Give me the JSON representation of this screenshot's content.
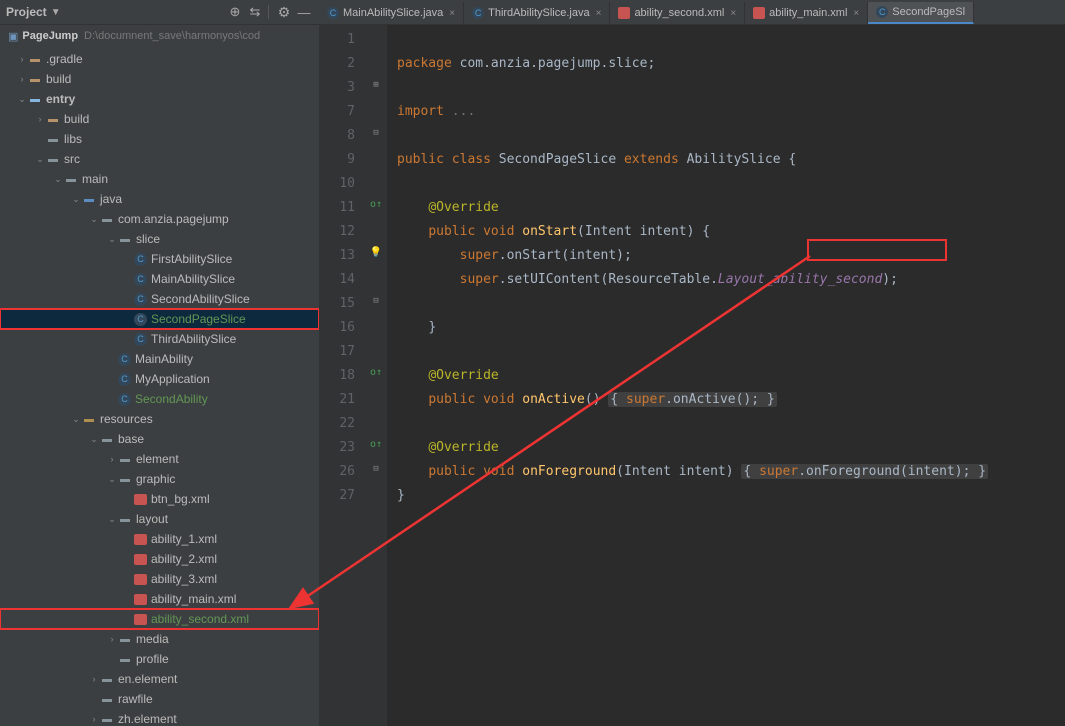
{
  "sidebar": {
    "header_title": "Project",
    "crumb_project": "PageJump",
    "crumb_path": "D:\\documnent_save\\harmonyos\\cod"
  },
  "tree": {
    "gradle": ".gradle",
    "build": "build",
    "entry": "entry",
    "entry_build": "build",
    "libs": "libs",
    "src": "src",
    "main": "main",
    "java": "java",
    "pkg": "com.anzia.pagejump",
    "slice": "slice",
    "first": "FirstAbilitySlice",
    "mainSlice": "MainAbilitySlice",
    "secondSlice": "SecondAbilitySlice",
    "secondPage": "SecondPageSlice",
    "thirdSlice": "ThirdAbilitySlice",
    "mainAbility": "MainAbility",
    "myApp": "MyApplication",
    "secondAbility": "SecondAbility",
    "resources": "resources",
    "base": "base",
    "element": "element",
    "graphic": "graphic",
    "btnbg": "btn_bg.xml",
    "layout": "layout",
    "a1": "ability_1.xml",
    "a2": "ability_2.xml",
    "a3": "ability_3.xml",
    "amain": "ability_main.xml",
    "asecond": "ability_second.xml",
    "media": "media",
    "profile": "profile",
    "enel": "en.element",
    "rawfile": "rawfile",
    "zhel": "zh.element"
  },
  "tabs": {
    "t1": "MainAbilitySlice.java",
    "t2": "ThirdAbilitySlice.java",
    "t3": "ability_second.xml",
    "t4": "ability_main.xml",
    "t5": "SecondPageSl"
  },
  "code": {
    "l1a": "package",
    "l1b": " com.anzia.pagejump.slice;",
    "l3a": "import",
    "l3b": " ...",
    "l8a": "public class ",
    "l8b": "SecondPageSlice ",
    "l8c": "extends ",
    "l8d": "AbilitySlice {",
    "l10": "@Override",
    "l11a": "public ",
    "l11b": "void ",
    "l11c": "onStart",
    "l11d": "(Intent intent) {",
    "l12a": "super",
    "l12b": ".onStart(intent);",
    "l13a": "super",
    "l13b": ".setUIContent(ResourceTable.",
    "l13c": "Layout",
    "l13d": "_ability_second",
    "l13e": ");",
    "l15": "}",
    "l17": "@Override",
    "l18a": "public ",
    "l18b": "void ",
    "l18c": "onActive",
    "l18d": "() ",
    "l18e": "{ ",
    "l18f": "super",
    "l18g": ".onActive(); ",
    "l18h": "}",
    "l22": "@Override",
    "l23a": "public ",
    "l23b": "void ",
    "l23c": "onForeground",
    "l23d": "(Intent intent) ",
    "l23e": "{ ",
    "l23f": "super",
    "l23g": ".onForeground(intent); ",
    "l23h": "}",
    "l26": "}"
  },
  "gutter": [
    "1",
    "2",
    "3",
    "7",
    "8",
    "9",
    "10",
    "11",
    "12",
    "13",
    "14",
    "15",
    "16",
    "17",
    "18",
    "21",
    "22",
    "23",
    "26",
    "27"
  ]
}
